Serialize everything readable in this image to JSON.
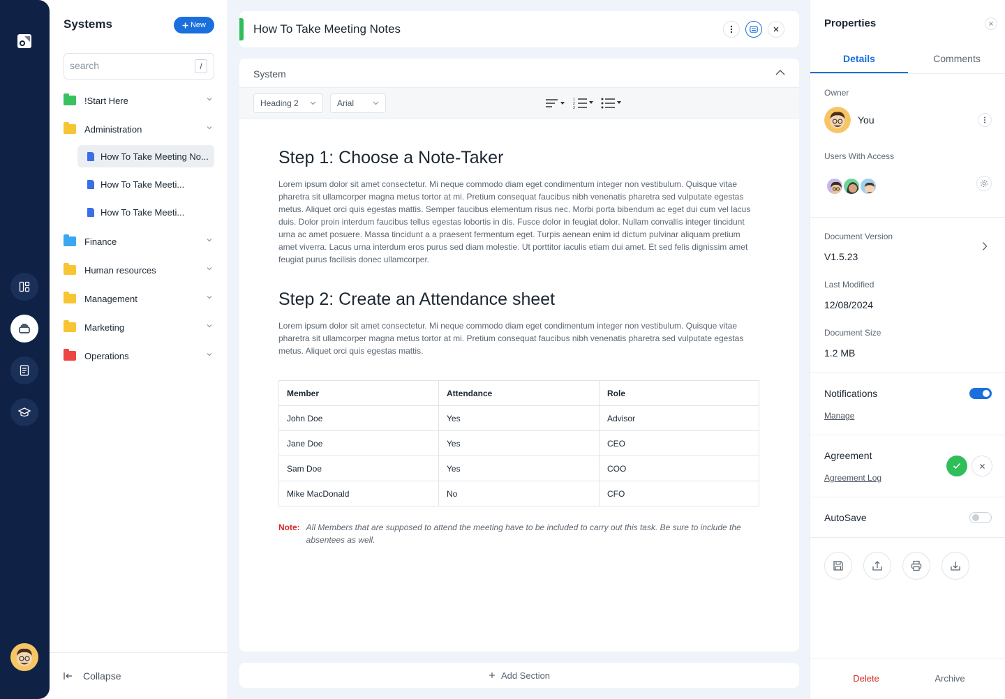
{
  "sidebar": {
    "title": "Systems",
    "new_label": "New",
    "search_placeholder": "search",
    "search_shortcut": "/",
    "folders": [
      {
        "label": "!Start Here",
        "color": "#39c05f"
      },
      {
        "label": "Administration",
        "color": "#f7c532"
      },
      {
        "label": "Finance",
        "color": "#3aa7f0"
      },
      {
        "label": "Human resources",
        "color": "#f7c532"
      },
      {
        "label": "Management",
        "color": "#f7c532"
      },
      {
        "label": "Marketing",
        "color": "#f7c532"
      },
      {
        "label": "Operations",
        "color": "#ef4444"
      }
    ],
    "docs": [
      {
        "label": "How To Take Meeting No..."
      },
      {
        "label": "How To Take Meeti..."
      },
      {
        "label": "How To Take Meeti..."
      }
    ],
    "collapse_label": "Collapse"
  },
  "doc": {
    "title": "How To Take Meeting Notes",
    "section_label": "System",
    "heading_select": "Heading 2",
    "font_select": "Arial",
    "step1_title": "Step 1: Choose a Note-Taker",
    "step1_body": "Lorem ipsum dolor sit amet consectetur. Mi neque commodo diam eget condimentum integer non vestibulum. Quisque vitae pharetra sit ullamcorper magna metus tortor at mi. Pretium consequat faucibus nibh venenatis pharetra sed vulputate egestas metus. Aliquet orci quis egestas mattis. Semper faucibus elementum risus nec. Morbi porta bibendum ac eget dui cum vel lacus duis. Dolor proin interdum faucibus tellus egestas lobortis in dis. Fusce dolor in feugiat dolor. Nullam convallis integer tincidunt urna ac amet posuere. Massa tincidunt a a praesent fermentum eget. Turpis aenean enim id dictum pulvinar aliquam pretium amet viverra. Lacus urna interdum eros purus sed diam molestie. Ut porttitor iaculis etiam dui amet. Et sed felis dignissim amet feugiat purus facilisis donec ullamcorper.",
    "step2_title": "Step 2: Create an Attendance sheet",
    "step2_body": "Lorem ipsum dolor sit amet consectetur. Mi neque commodo diam eget condimentum integer non vestibulum. Quisque vitae pharetra sit ullamcorper magna metus tortor at mi. Pretium consequat faucibus nibh venenatis pharetra sed vulputate egestas metus. Aliquet orci quis egestas mattis.",
    "table": {
      "headers": [
        "Member",
        "Attendance",
        "Role"
      ],
      "rows": [
        [
          "John Doe",
          "Yes",
          "Advisor"
        ],
        [
          "Jane Doe",
          "Yes",
          "CEO"
        ],
        [
          "Sam Doe",
          "Yes",
          "COO"
        ],
        [
          "Mike MacDonald",
          "No",
          "CFO"
        ]
      ]
    },
    "note_label": "Note:",
    "note_text": "All Members that are supposed to attend the meeting have to be included to carry out this task. Be sure to include the absentees as well.",
    "add_section_label": "Add Section"
  },
  "properties": {
    "title": "Properties",
    "tab_details": "Details",
    "tab_comments": "Comments",
    "owner_label": "Owner",
    "owner_name": "You",
    "users_label": "Users With Access",
    "version_label": "Document Version",
    "version_value": "V1.5.23",
    "modified_label": "Last Modified",
    "modified_value": "12/08/2024",
    "size_label": "Document Size",
    "size_value": "1.2 MB",
    "notifications_label": "Notifications",
    "notifications_on": true,
    "manage_label": "Manage",
    "agreement_label": "Agreement",
    "agreement_log_label": "Agreement Log",
    "autosave_label": "AutoSave",
    "autosave_on": false,
    "delete_label": "Delete",
    "archive_label": "Archive"
  },
  "colors": {
    "accent": "#1b6fdc",
    "nav": "#0f2245",
    "success": "#2fbe5a",
    "danger": "#d62828"
  }
}
